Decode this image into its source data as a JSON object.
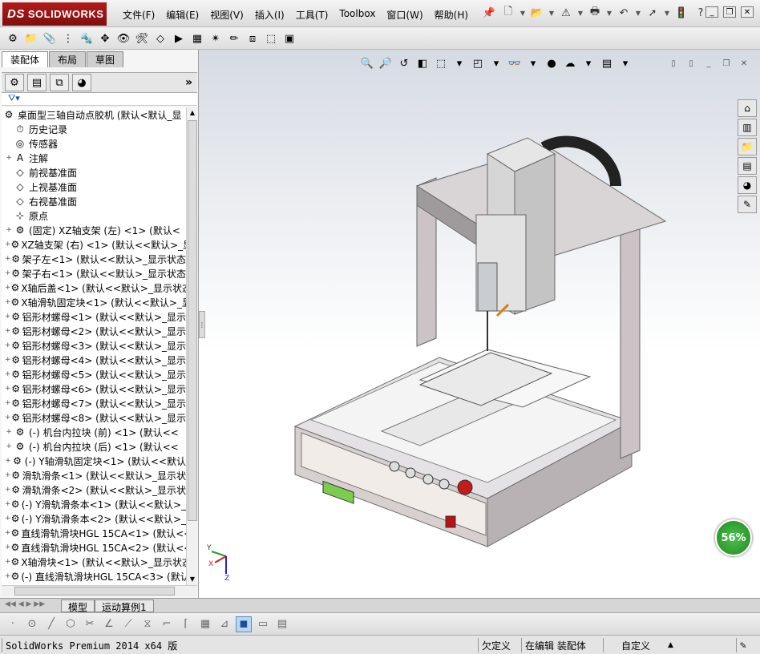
{
  "app": {
    "logo_mark": "DS",
    "logo_text": "SOLIDWORKS"
  },
  "menu": [
    {
      "label": "文件(F)"
    },
    {
      "label": "编辑(E)"
    },
    {
      "label": "视图(V)"
    },
    {
      "label": "插入(I)"
    },
    {
      "label": "工具(T)"
    },
    {
      "label": "Toolbox"
    },
    {
      "label": "窗口(W)"
    },
    {
      "label": "帮助(H)"
    }
  ],
  "panel": {
    "tabs": [
      {
        "label": "装配体"
      },
      {
        "label": "布局"
      },
      {
        "label": "草图"
      }
    ],
    "more": "»"
  },
  "tree": {
    "root": {
      "label": "桌面型三轴自动点胶机  (默认<默认_显"
    },
    "items": [
      {
        "label": "历史记录",
        "icon": "history-icon",
        "expand": ""
      },
      {
        "label": "传感器",
        "icon": "sensor-icon",
        "expand": ""
      },
      {
        "label": "注解",
        "icon": "annotation-icon",
        "expand": "+"
      },
      {
        "label": "前视基准面",
        "icon": "plane-icon",
        "expand": ""
      },
      {
        "label": "上视基准面",
        "icon": "plane-icon",
        "expand": ""
      },
      {
        "label": "右视基准面",
        "icon": "plane-icon",
        "expand": ""
      },
      {
        "label": "原点",
        "icon": "origin-icon",
        "expand": ""
      },
      {
        "label": "(固定) XZ轴支架 (左) <1> (默认<",
        "icon": "part-icon",
        "expand": "+"
      },
      {
        "label": "XZ轴支架 (右) <1> (默认<<默认>_显",
        "icon": "part-icon",
        "expand": "+"
      },
      {
        "label": "架子左<1> (默认<<默认>_显示状态",
        "icon": "part-icon",
        "expand": "+"
      },
      {
        "label": "架子右<1> (默认<<默认>_显示状态",
        "icon": "part-icon",
        "expand": "+"
      },
      {
        "label": "X轴后盖<1> (默认<<默认>_显示状态",
        "icon": "part-icon",
        "expand": "+"
      },
      {
        "label": "X轴滑轨固定块<1> (默认<<默认>_显",
        "icon": "part-icon",
        "expand": "+"
      },
      {
        "label": "铝形材螺母<1> (默认<<默认>_显示",
        "icon": "part-icon",
        "expand": "+"
      },
      {
        "label": "铝形材螺母<2> (默认<<默认>_显示",
        "icon": "part-icon",
        "expand": "+"
      },
      {
        "label": "铝形材螺母<3> (默认<<默认>_显示",
        "icon": "part-icon",
        "expand": "+"
      },
      {
        "label": "铝形材螺母<4> (默认<<默认>_显示",
        "icon": "part-icon",
        "expand": "+"
      },
      {
        "label": "铝形材螺母<5> (默认<<默认>_显示",
        "icon": "part-icon",
        "expand": "+"
      },
      {
        "label": "铝形材螺母<6> (默认<<默认>_显示",
        "icon": "part-icon",
        "expand": "+"
      },
      {
        "label": "铝形材螺母<7> (默认<<默认>_显示",
        "icon": "part-icon",
        "expand": "+"
      },
      {
        "label": "铝形材螺母<8> (默认<<默认>_显示",
        "icon": "part-icon",
        "expand": "+"
      },
      {
        "label": "(-) 机台内拉块 (前) <1> (默认<<",
        "icon": "part-icon",
        "expand": "+"
      },
      {
        "label": "(-) 机台内拉块 (后) <1> (默认<<",
        "icon": "part-icon",
        "expand": "+"
      },
      {
        "label": "(-) Y轴滑轨固定块<1> (默认<<默认",
        "icon": "part-icon",
        "expand": "+"
      },
      {
        "label": "滑轨滑条<1> (默认<<默认>_显示状",
        "icon": "part-icon",
        "expand": "+"
      },
      {
        "label": "滑轨滑条<2> (默认<<默认>_显示状",
        "icon": "part-icon",
        "expand": "+"
      },
      {
        "label": "(-) Y滑轨滑条本<1> (默认<<默认>_",
        "icon": "part-icon",
        "expand": "+"
      },
      {
        "label": "(-) Y滑轨滑条本<2> (默认<<默认>_",
        "icon": "part-icon",
        "expand": "+"
      },
      {
        "label": "直线滑轨滑块HGL 15CA<1> (默认<<",
        "icon": "part-icon",
        "expand": "+"
      },
      {
        "label": "直线滑轨滑块HGL 15CA<2> (默认<<",
        "icon": "part-icon",
        "expand": "+"
      },
      {
        "label": "X轴滑块<1> (默认<<默认>_显示状态",
        "icon": "part-icon",
        "expand": "+"
      },
      {
        "label": "(-) 直线滑轨滑块HGL 15CA<3> (默认",
        "icon": "part-icon",
        "expand": "+"
      }
    ]
  },
  "viewport": {
    "progress_label": "56%",
    "progress_value": 0.56,
    "triad": {
      "x": "X",
      "y": "Y",
      "z": "Z"
    }
  },
  "bottom_tabs": [
    {
      "label": "模型"
    },
    {
      "label": "运动算例1"
    }
  ],
  "status": {
    "product": "SolidWorks Premium 2014 x64 版",
    "undefined": "欠定义",
    "editing": "在编辑 装配体",
    "custom": "自定义",
    "custom_arrow": "▲"
  },
  "colors": {
    "logo_red": "#9a1414",
    "progress_green": "#2aa52a",
    "viewport_top": "#d6dbe3"
  }
}
